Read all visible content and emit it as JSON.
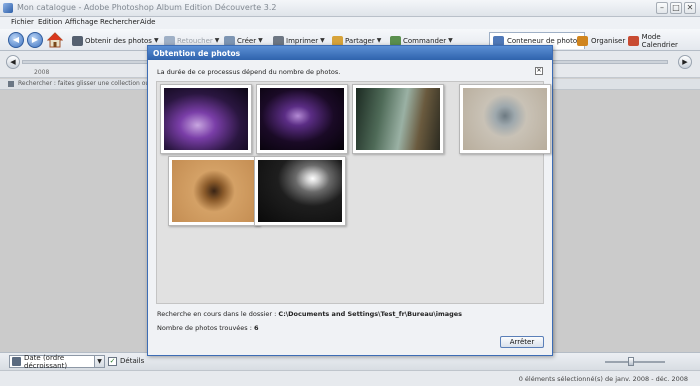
{
  "window": {
    "title": "Mon catalogue - Adobe Photoshop Album Edition Découverte 3.2",
    "min": "–",
    "max": "□",
    "close": "✕"
  },
  "menu": [
    "Fichier",
    "Edition",
    "Affichage",
    "Rechercher",
    "Aide"
  ],
  "toolbar": {
    "get_photos": "Obtenir des photos",
    "retouch": "Retoucher",
    "create": "Créer",
    "print": "Imprimer",
    "share": "Partager",
    "order": "Commander",
    "photo_well": "Conteneur de photos",
    "organize": "Organiser",
    "calendar": "Mode Calendrier",
    "arrow": "▼"
  },
  "timeline": {
    "year": "2008"
  },
  "hint": "Rechercher : faites glisser une collection ou des étiquettes",
  "bottombar": {
    "sort": "Date (ordre décroissant)",
    "details": "Détails",
    "details_checked": "✓"
  },
  "status": "0 éléments sélectionné(s) de janv. 2008 - déc. 2008",
  "dialog": {
    "title": "Obtention de photos",
    "description": "La durée de ce processus dépend du nombre de photos.",
    "search_prefix": "Recherche en cours dans le dossier : ",
    "search_path": "C:\\Documents and Settings\\Test_fr\\Bureau\\images",
    "count_prefix": "Nombre de photos trouvées : ",
    "count": "6",
    "stop": "Arrêter",
    "close": "✕"
  },
  "colors": {
    "dialog_title": "#2f63ad",
    "accent": "#3d6db5"
  }
}
